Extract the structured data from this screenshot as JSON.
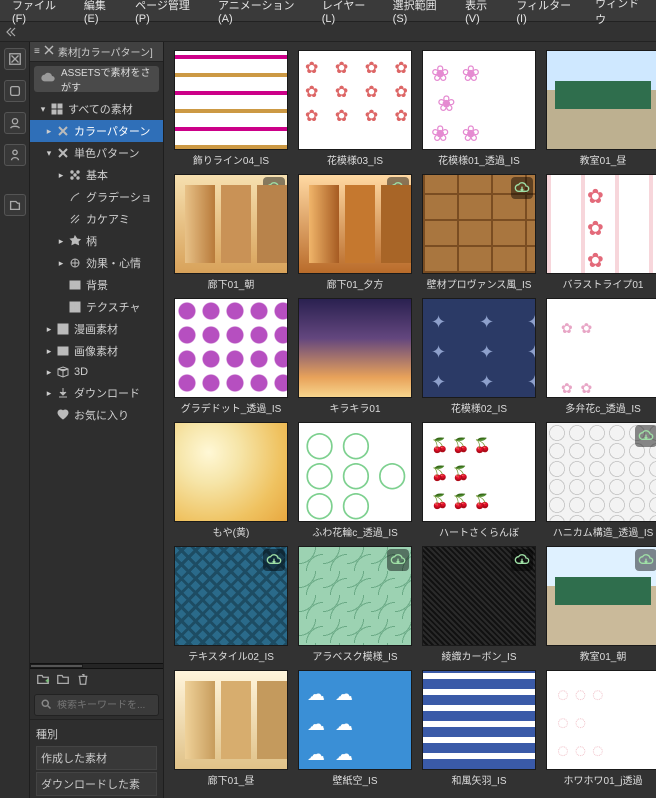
{
  "menubar": [
    {
      "label": "ファイル(F)"
    },
    {
      "label": "編集(E)"
    },
    {
      "label": "ページ管理(P)"
    },
    {
      "label": "アニメーション(A)"
    },
    {
      "label": "レイヤー(L)"
    },
    {
      "label": "選択範囲(S)"
    },
    {
      "label": "表示(V)"
    },
    {
      "label": "フィルター(I)"
    },
    {
      "label": "ウィンドウ"
    }
  ],
  "panel": {
    "title": "素材[カラーパターン]",
    "assets_button": "ASSETSで素材をさがす"
  },
  "tree": [
    {
      "label": "すべての素材",
      "depth": 0,
      "arrow": "v",
      "icon": "all"
    },
    {
      "label": "カラーパターン",
      "depth": 1,
      "sel": true,
      "arrow": ">",
      "icon": "x"
    },
    {
      "label": "単色パターン",
      "depth": 1,
      "arrow": "v",
      "icon": "x"
    },
    {
      "label": "基本",
      "depth": 2,
      "arrow": ">",
      "icon": "grid"
    },
    {
      "label": "グラデーショ",
      "depth": 2,
      "arrow": "",
      "icon": "grad"
    },
    {
      "label": "カケアミ",
      "depth": 2,
      "arrow": "",
      "icon": "hatch"
    },
    {
      "label": "柄",
      "depth": 2,
      "arrow": ">",
      "icon": "pattern"
    },
    {
      "label": "効果・心情",
      "depth": 2,
      "arrow": ">",
      "icon": "fx"
    },
    {
      "label": "背景",
      "depth": 2,
      "arrow": "",
      "icon": "bg"
    },
    {
      "label": "テクスチャ",
      "depth": 2,
      "arrow": "",
      "icon": "tex"
    },
    {
      "label": "漫画素材",
      "depth": 1,
      "arrow": ">",
      "icon": "manga"
    },
    {
      "label": "画像素材",
      "depth": 1,
      "arrow": ">",
      "icon": "image"
    },
    {
      "label": "3D",
      "depth": 1,
      "arrow": ">",
      "icon": "cube"
    },
    {
      "label": "ダウンロード",
      "depth": 1,
      "arrow": ">",
      "icon": "dl"
    },
    {
      "label": "お気に入り",
      "depth": 1,
      "arrow": "",
      "icon": "heart"
    }
  ],
  "search_placeholder": "検索キーワードを...",
  "filter": {
    "heading": "種別",
    "options": [
      "作成した素材",
      "ダウンロードした素"
    ]
  },
  "materials": [
    {
      "name": "飾りライン04_IS",
      "cls": "t-stripes",
      "dl": false
    },
    {
      "name": "花模様03_IS",
      "cls": "t-flower1",
      "dl": false
    },
    {
      "name": "花模様01_透過_IS",
      "cls": "t-flower2",
      "dl": false
    },
    {
      "name": "教室01_昼",
      "cls": "t-class-day",
      "dl": false
    },
    {
      "name": "廊下01_朝",
      "cls": "t-hall-morn",
      "dl": true
    },
    {
      "name": "廊下01_夕方",
      "cls": "t-hall-eve",
      "dl": true
    },
    {
      "name": "壁材プロヴァンス風_IS",
      "cls": "t-brick",
      "dl": true
    },
    {
      "name": "バラストライプ01",
      "cls": "t-rose",
      "dl": false
    },
    {
      "name": "グラデドット_透過_IS",
      "cls": "t-dots",
      "dl": false
    },
    {
      "name": "キラキラ01",
      "cls": "t-kira",
      "dl": false
    },
    {
      "name": "花模様02_IS",
      "cls": "t-damask",
      "dl": false
    },
    {
      "name": "多弁花c_透過_IS",
      "cls": "t-smallfl",
      "dl": false
    },
    {
      "name": "もや(黄)",
      "cls": "t-moya",
      "dl": false
    },
    {
      "name": "ふわ花輪c_透過_IS",
      "cls": "t-ring",
      "dl": false
    },
    {
      "name": "ハートさくらんぼ",
      "cls": "t-cherry",
      "dl": false
    },
    {
      "name": "ハニカム構造_透過_IS",
      "cls": "t-honey",
      "dl": true
    },
    {
      "name": "テキスタイル02_IS",
      "cls": "t-text02",
      "dl": true
    },
    {
      "name": "アラベスク模様_IS",
      "cls": "t-arab",
      "dl": true
    },
    {
      "name": "綾織カーボン_IS",
      "cls": "t-carbon",
      "dl": true
    },
    {
      "name": "教室01_朝",
      "cls": "t-class-morn",
      "dl": true
    },
    {
      "name": "廊下01_昼",
      "cls": "t-hall-day",
      "dl": false
    },
    {
      "name": "壁紙空_IS",
      "cls": "t-sky",
      "dl": false
    },
    {
      "name": "和風矢羽_IS",
      "cls": "t-yab",
      "dl": false
    },
    {
      "name": "ホワホワ01_j透過",
      "cls": "t-howa",
      "dl": false
    }
  ]
}
